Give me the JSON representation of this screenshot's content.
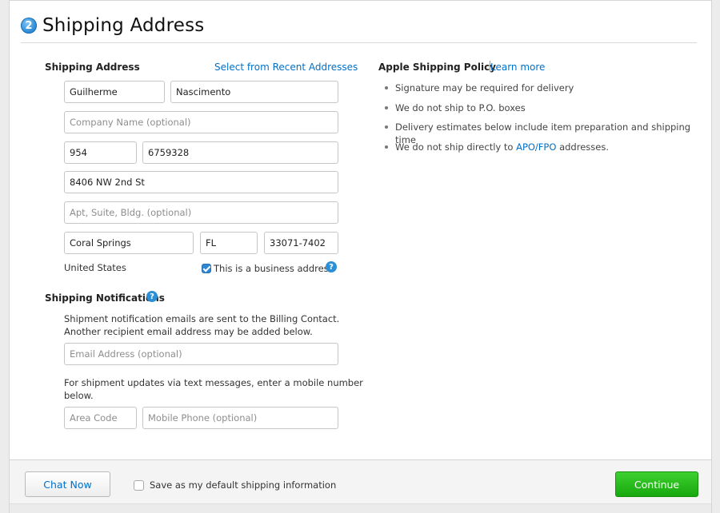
{
  "header": {
    "step_number": "2",
    "title": "Shipping Address"
  },
  "address": {
    "section_label": "Shipping Address",
    "recent_link": "Select from Recent Addresses",
    "first_name": "Guilherme",
    "last_name": "Nascimento",
    "company_placeholder": "Company Name (optional)",
    "area_code": "954",
    "phone": "6759328",
    "street": "8406 NW 2nd St",
    "apt_placeholder": "Apt, Suite, Bldg. (optional)",
    "city": "Coral Springs",
    "state": "FL",
    "zip": "33071-7402",
    "country": "United States",
    "business_label": "This is a business address",
    "business_checked": true
  },
  "notifications": {
    "section_label": "Shipping Notifications",
    "email_note_line1": "Shipment notification emails are sent to the Billing Contact.",
    "email_note_line2": "Another recipient email address may be added below.",
    "email_placeholder": "Email Address (optional)",
    "sms_note_line1": "For shipment updates via text messages, enter a mobile number",
    "sms_note_line2": "below.",
    "area_code_placeholder": "Area Code",
    "mobile_placeholder": "Mobile Phone (optional)"
  },
  "policy": {
    "title": "Apple Shipping Policy",
    "learn_more": "Learn more",
    "items": [
      "Signature may be required for delivery",
      "We do not ship to P.O. boxes",
      "Delivery estimates below include item preparation and shipping time"
    ],
    "apo_prefix": "We do not ship directly to ",
    "apo_link": "APO/FPO",
    "apo_suffix": " addresses."
  },
  "footer": {
    "chat_label": "Chat Now",
    "save_default_label": "Save as my default shipping information",
    "continue_label": "Continue"
  },
  "colors": {
    "link": "#0070c9",
    "continue": "#17a80e",
    "checkbox": "#2f86d4"
  },
  "icons": {
    "step": "step-number-badge-icon",
    "help": "question-mark-icon",
    "check": "checkmark-icon"
  }
}
